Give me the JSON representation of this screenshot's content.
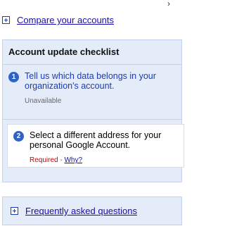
{
  "compare": {
    "label": "Compare your accounts"
  },
  "checklist": {
    "title": "Account update checklist",
    "steps": [
      {
        "number": "1",
        "title": "Tell us which data belongs in your organization's account.",
        "status": "Unavailable"
      },
      {
        "number": "2",
        "title": "Select a different address for your personal Google Account.",
        "required_label": "Required",
        "separator": " - ",
        "help_link": "Why?"
      }
    ]
  },
  "faq": {
    "label": "Frequently asked questions"
  },
  "colors": {
    "link": "#1a0dab",
    "panel_bg": "#e5ecf9",
    "panel_border": "#c3d1ec",
    "step_number_bg": "#2e62c4",
    "required": "#cc0000",
    "muted": "#666666"
  }
}
